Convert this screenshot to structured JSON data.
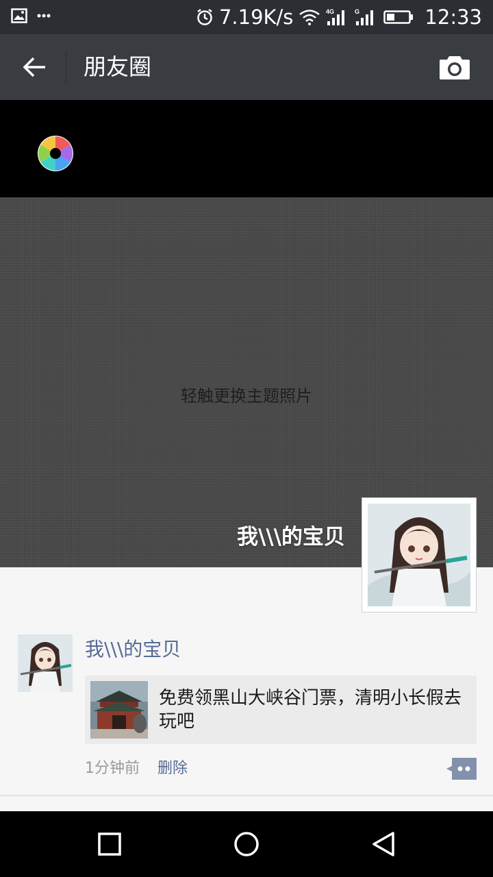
{
  "status_bar": {
    "net_speed": "7.19K/s",
    "time": "12:33",
    "icons": [
      "image-icon",
      "more-dots-icon",
      "alarm-icon",
      "wifi-icon",
      "signal-4g-icon",
      "signal-g-icon",
      "battery-icon"
    ]
  },
  "nav": {
    "title": "朋友圈",
    "back_icon": "arrow-left-icon",
    "camera_icon": "camera-icon"
  },
  "cover": {
    "hint": "轻触更换主题照片",
    "profile_name": "我\\\\\\的宝贝"
  },
  "post": {
    "author": "我\\\\\\的宝贝",
    "link_text": "免费领黑山大峡谷门票，清明小长假去玩吧",
    "time": "1分钟前",
    "delete_label": "删除"
  },
  "system_nav": {
    "icons": [
      "recent-apps-icon",
      "home-icon",
      "back-icon"
    ]
  },
  "colors": {
    "status_bar": "#2b2f33",
    "nav_bar": "#393d42",
    "link_blue": "#576b95",
    "feed_bg": "#f6f6f6"
  }
}
